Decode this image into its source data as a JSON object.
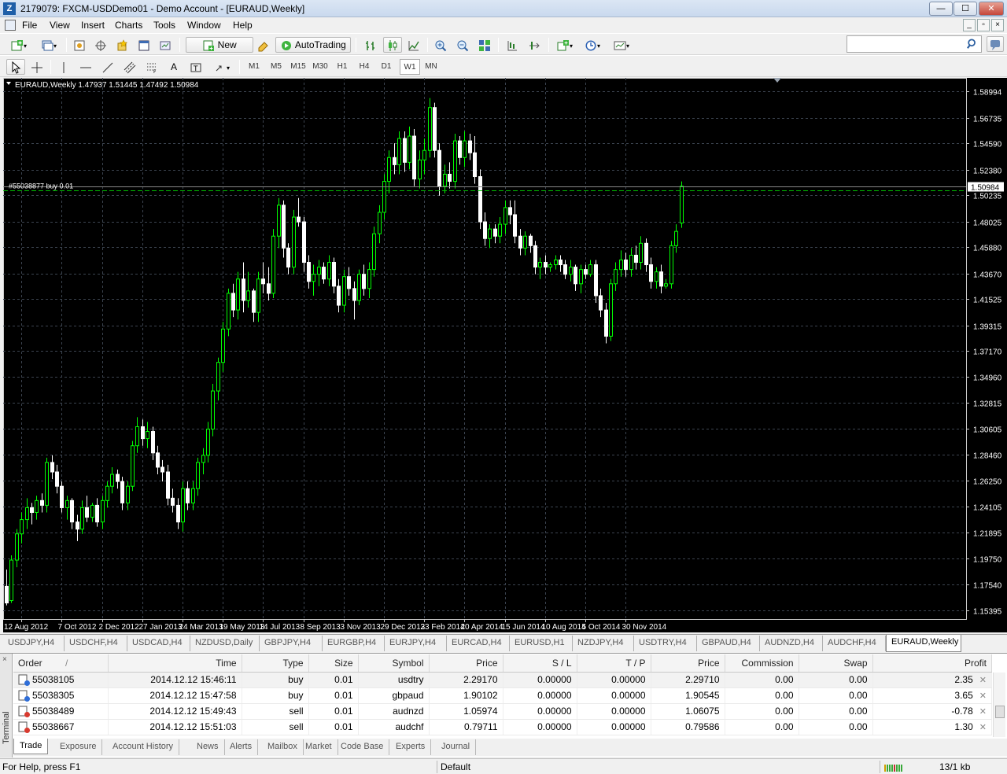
{
  "window": {
    "title": "2179079: FXCM-USDDemo01 - Demo Account - [EURAUD,Weekly]",
    "minimize": "—",
    "maximize": "☐",
    "close": "✕"
  },
  "menu": [
    "File",
    "View",
    "Insert",
    "Charts",
    "Tools",
    "Window",
    "Help"
  ],
  "toolbar": {
    "new_order_label": "New Order",
    "autotrading_label": "AutoTrading",
    "timeframes": [
      "M1",
      "M5",
      "M15",
      "M30",
      "H1",
      "H4",
      "D1",
      "W1",
      "MN"
    ],
    "active_timeframe": "W1",
    "search_placeholder": ""
  },
  "chart": {
    "header": "EURAUD,Weekly  1.47937 1.51445 1.47492 1.50984",
    "order_line_label": "#55038877 buy 0.01",
    "current_price": "1.50984",
    "price_labels": [
      "1.58994",
      "1.56735",
      "1.54590",
      "1.52380",
      "1.50235",
      "1.48025",
      "1.45880",
      "1.43670",
      "1.41525",
      "1.39315",
      "1.37170",
      "1.34960",
      "1.32815",
      "1.30605",
      "1.28460",
      "1.26250",
      "1.24105",
      "1.21895",
      "1.19750",
      "1.17540",
      "1.15395"
    ],
    "date_labels": [
      "12 Aug 2012",
      "7 Oct 2012",
      "2 Dec 2012",
      "27 Jan 2013",
      "24 Mar 2013",
      "19 May 2013",
      "14 Jul 2013",
      "8 Sep 2013",
      "3 Nov 2013",
      "29 Dec 2013",
      "23 Feb 2014",
      "20 Apr 2014",
      "15 Jun 2014",
      "10 Aug 2014",
      "5 Oct 2014",
      "30 Nov 2014"
    ],
    "bull_color": "#00ff00",
    "bear_color": "#ffffff",
    "background": "#000000",
    "grid_color": "#3c4450"
  },
  "chart_tabs": [
    "USDJPY,H4",
    "USDCHF,H4",
    "USDCAD,H4",
    "NZDUSD,Daily",
    "GBPJPY,H4",
    "EURGBP,H4",
    "EURJPY,H4",
    "EURCAD,H4",
    "EURUSD,H1",
    "NZDJPY,H4",
    "USDTRY,H4",
    "GBPAUD,H4",
    "AUDNZD,H4",
    "AUDCHF,H4",
    "EURAUD,Weekly"
  ],
  "active_chart_tab": "EURAUD,Weekly",
  "terminal": {
    "side_label": "Terminal",
    "close_x": "×",
    "columns": [
      "Order",
      "Time",
      "Type",
      "Size",
      "Symbol",
      "Price",
      "S / L",
      "T / P",
      "Price",
      "Commission",
      "Swap",
      "Profit"
    ],
    "sort_marker": "/",
    "rows": [
      {
        "order": "55038105",
        "time": "2014.12.12 15:46:11",
        "type": "buy",
        "size": "0.01",
        "symbol": "usdtry",
        "price": "2.29170",
        "sl": "0.00000",
        "tp": "0.00000",
        "cur_price": "2.29710",
        "commission": "0.00",
        "swap": "0.00",
        "profit": "2.35"
      },
      {
        "order": "55038305",
        "time": "2014.12.12 15:47:58",
        "type": "buy",
        "size": "0.01",
        "symbol": "gbpaud",
        "price": "1.90102",
        "sl": "0.00000",
        "tp": "0.00000",
        "cur_price": "1.90545",
        "commission": "0.00",
        "swap": "0.00",
        "profit": "3.65"
      },
      {
        "order": "55038489",
        "time": "2014.12.12 15:49:43",
        "type": "sell",
        "size": "0.01",
        "symbol": "audnzd",
        "price": "1.05974",
        "sl": "0.00000",
        "tp": "0.00000",
        "cur_price": "1.06075",
        "commission": "0.00",
        "swap": "0.00",
        "profit": "-0.78"
      },
      {
        "order": "55038667",
        "time": "2014.12.12 15:51:03",
        "type": "sell",
        "size": "0.01",
        "symbol": "audchf",
        "price": "0.79711",
        "sl": "0.00000",
        "tp": "0.00000",
        "cur_price": "0.79586",
        "commission": "0.00",
        "swap": "0.00",
        "profit": "1.30"
      }
    ],
    "tabs": [
      "Trade",
      "Exposure",
      "Account History",
      "News",
      "Alerts",
      "Mailbox",
      "Market",
      "Code Base",
      "Experts",
      "Journal"
    ],
    "active_tab": "Trade"
  },
  "status": {
    "help": "For Help, press F1",
    "profile": "Default",
    "traffic": "13/1 kb"
  },
  "chart_data": {
    "type": "candlestick",
    "title": "EURAUD,Weekly",
    "ohlc_last": {
      "open": 1.47937,
      "high": 1.51445,
      "low": 1.47492,
      "close": 1.50984
    },
    "ylim": [
      1.1465,
      1.6009
    ],
    "x_start": "2012-07-22",
    "x_step_days": 7,
    "candles": [
      [
        1.174,
        1.188,
        1.158,
        1.16
      ],
      [
        1.162,
        1.2,
        1.16,
        1.196
      ],
      [
        1.196,
        1.222,
        1.19,
        1.218
      ],
      [
        1.218,
        1.236,
        1.21,
        1.23
      ],
      [
        1.23,
        1.248,
        1.222,
        1.24
      ],
      [
        1.24,
        1.244,
        1.226,
        1.236
      ],
      [
        1.236,
        1.25,
        1.23,
        1.246
      ],
      [
        1.246,
        1.252,
        1.236,
        1.242
      ],
      [
        1.242,
        1.282,
        1.236,
        1.278
      ],
      [
        1.278,
        1.284,
        1.264,
        1.27
      ],
      [
        1.27,
        1.276,
        1.252,
        1.258
      ],
      [
        1.258,
        1.262,
        1.236,
        1.24
      ],
      [
        1.24,
        1.25,
        1.23,
        1.246
      ],
      [
        1.246,
        1.248,
        1.222,
        1.228
      ],
      [
        1.228,
        1.234,
        1.212,
        1.222
      ],
      [
        1.222,
        1.246,
        1.218,
        1.24
      ],
      [
        1.24,
        1.25,
        1.228,
        1.232
      ],
      [
        1.232,
        1.244,
        1.228,
        1.242
      ],
      [
        1.242,
        1.248,
        1.224,
        1.228
      ],
      [
        1.228,
        1.25,
        1.222,
        1.246
      ],
      [
        1.246,
        1.262,
        1.24,
        1.258
      ],
      [
        1.258,
        1.274,
        1.252,
        1.268
      ],
      [
        1.268,
        1.272,
        1.256,
        1.262
      ],
      [
        1.262,
        1.266,
        1.238,
        1.244
      ],
      [
        1.244,
        1.262,
        1.238,
        1.258
      ],
      [
        1.258,
        1.296,
        1.254,
        1.292
      ],
      [
        1.292,
        1.316,
        1.286,
        1.308
      ],
      [
        1.308,
        1.314,
        1.292,
        1.298
      ],
      [
        1.298,
        1.312,
        1.29,
        1.304
      ],
      [
        1.304,
        1.308,
        1.28,
        1.286
      ],
      [
        1.286,
        1.292,
        1.268,
        1.274
      ],
      [
        1.274,
        1.28,
        1.262,
        1.27
      ],
      [
        1.27,
        1.276,
        1.242,
        1.248
      ],
      [
        1.248,
        1.256,
        1.236,
        1.242
      ],
      [
        1.242,
        1.248,
        1.222,
        1.228
      ],
      [
        1.228,
        1.262,
        1.22,
        1.256
      ],
      [
        1.256,
        1.262,
        1.238,
        1.244
      ],
      [
        1.244,
        1.262,
        1.238,
        1.256
      ],
      [
        1.256,
        1.282,
        1.25,
        1.278
      ],
      [
        1.278,
        1.29,
        1.268,
        1.284
      ],
      [
        1.284,
        1.312,
        1.278,
        1.306
      ],
      [
        1.306,
        1.344,
        1.3,
        1.338
      ],
      [
        1.338,
        1.366,
        1.33,
        1.362
      ],
      [
        1.362,
        1.396,
        1.354,
        1.39
      ],
      [
        1.39,
        1.424,
        1.384,
        1.42
      ],
      [
        1.42,
        1.428,
        1.4,
        1.406
      ],
      [
        1.406,
        1.438,
        1.398,
        1.432
      ],
      [
        1.432,
        1.446,
        1.404,
        1.414
      ],
      [
        1.414,
        1.438,
        1.408,
        1.422
      ],
      [
        1.422,
        1.424,
        1.396,
        1.404
      ],
      [
        1.404,
        1.438,
        1.396,
        1.432
      ],
      [
        1.432,
        1.446,
        1.42,
        1.428
      ],
      [
        1.428,
        1.442,
        1.414,
        1.42
      ],
      [
        1.42,
        1.474,
        1.416,
        1.468
      ],
      [
        1.468,
        1.5,
        1.458,
        1.494
      ],
      [
        1.494,
        1.498,
        1.45,
        1.458
      ],
      [
        1.458,
        1.462,
        1.436,
        1.442
      ],
      [
        1.442,
        1.49,
        1.436,
        1.484
      ],
      [
        1.484,
        1.5,
        1.476,
        1.48
      ],
      [
        1.48,
        1.484,
        1.438,
        1.446
      ],
      [
        1.446,
        1.452,
        1.424,
        1.43
      ],
      [
        1.43,
        1.444,
        1.418,
        1.436
      ],
      [
        1.436,
        1.448,
        1.426,
        1.442
      ],
      [
        1.442,
        1.446,
        1.428,
        1.432
      ],
      [
        1.432,
        1.452,
        1.426,
        1.446
      ],
      [
        1.446,
        1.45,
        1.42,
        1.426
      ],
      [
        1.426,
        1.432,
        1.404,
        1.41
      ],
      [
        1.41,
        1.44,
        1.404,
        1.434
      ],
      [
        1.434,
        1.442,
        1.418,
        1.424
      ],
      [
        1.424,
        1.43,
        1.398,
        1.414
      ],
      [
        1.414,
        1.44,
        1.41,
        1.436
      ],
      [
        1.436,
        1.444,
        1.418,
        1.424
      ],
      [
        1.424,
        1.446,
        1.416,
        1.44
      ],
      [
        1.44,
        1.476,
        1.434,
        1.47
      ],
      [
        1.47,
        1.494,
        1.462,
        1.488
      ],
      [
        1.488,
        1.52,
        1.482,
        1.514
      ],
      [
        1.514,
        1.54,
        1.504,
        1.534
      ],
      [
        1.534,
        1.546,
        1.52,
        1.528
      ],
      [
        1.528,
        1.556,
        1.52,
        1.55
      ],
      [
        1.55,
        1.556,
        1.522,
        1.53
      ],
      [
        1.53,
        1.56,
        1.524,
        1.552
      ],
      [
        1.552,
        1.558,
        1.51,
        1.516
      ],
      [
        1.516,
        1.54,
        1.508,
        1.532
      ],
      [
        1.532,
        1.55,
        1.52,
        1.54
      ],
      [
        1.54,
        1.584,
        1.534,
        1.576
      ],
      [
        1.576,
        1.58,
        1.534,
        1.54
      ],
      [
        1.54,
        1.546,
        1.502,
        1.51
      ],
      [
        1.51,
        1.528,
        1.504,
        1.52
      ],
      [
        1.52,
        1.53,
        1.508,
        1.514
      ],
      [
        1.514,
        1.554,
        1.508,
        1.548
      ],
      [
        1.548,
        1.552,
        1.528,
        1.534
      ],
      [
        1.534,
        1.556,
        1.526,
        1.548
      ],
      [
        1.548,
        1.554,
        1.532,
        1.538
      ],
      [
        1.538,
        1.552,
        1.512,
        1.518
      ],
      [
        1.518,
        1.524,
        1.474,
        1.48
      ],
      [
        1.48,
        1.488,
        1.46,
        1.466
      ],
      [
        1.466,
        1.478,
        1.458,
        1.474
      ],
      [
        1.474,
        1.478,
        1.462,
        1.468
      ],
      [
        1.468,
        1.484,
        1.462,
        1.478
      ],
      [
        1.478,
        1.498,
        1.47,
        1.492
      ],
      [
        1.492,
        1.498,
        1.478,
        1.486
      ],
      [
        1.486,
        1.498,
        1.462,
        1.468
      ],
      [
        1.468,
        1.474,
        1.452,
        1.458
      ],
      [
        1.458,
        1.472,
        1.452,
        1.468
      ],
      [
        1.468,
        1.47,
        1.454,
        1.46
      ],
      [
        1.46,
        1.464,
        1.436,
        1.442
      ],
      [
        1.442,
        1.45,
        1.432,
        1.446
      ],
      [
        1.446,
        1.452,
        1.436,
        1.442
      ],
      [
        1.442,
        1.446,
        1.438,
        1.444
      ],
      [
        1.444,
        1.452,
        1.44,
        1.448
      ],
      [
        1.448,
        1.452,
        1.438,
        1.444
      ],
      [
        1.444,
        1.448,
        1.432,
        1.436
      ],
      [
        1.436,
        1.448,
        1.43,
        1.442
      ],
      [
        1.442,
        1.444,
        1.422,
        1.428
      ],
      [
        1.428,
        1.444,
        1.42,
        1.44
      ],
      [
        1.44,
        1.444,
        1.432,
        1.436
      ],
      [
        1.436,
        1.448,
        1.434,
        1.444
      ],
      [
        1.444,
        1.448,
        1.412,
        1.418
      ],
      [
        1.418,
        1.424,
        1.4,
        1.406
      ],
      [
        1.406,
        1.412,
        1.378,
        1.384
      ],
      [
        1.384,
        1.432,
        1.38,
        1.428
      ],
      [
        1.428,
        1.446,
        1.422,
        1.44
      ],
      [
        1.44,
        1.456,
        1.434,
        1.448
      ],
      [
        1.448,
        1.454,
        1.434,
        1.44
      ],
      [
        1.44,
        1.458,
        1.434,
        1.452
      ],
      [
        1.452,
        1.46,
        1.44,
        1.446
      ],
      [
        1.446,
        1.468,
        1.44,
        1.462
      ],
      [
        1.462,
        1.466,
        1.438,
        1.444
      ],
      [
        1.444,
        1.45,
        1.424,
        1.43
      ],
      [
        1.43,
        1.442,
        1.424,
        1.438
      ],
      [
        1.438,
        1.444,
        1.42,
        1.426
      ],
      [
        1.426,
        1.432,
        1.424,
        1.428
      ],
      [
        1.428,
        1.464,
        1.424,
        1.46
      ],
      [
        1.46,
        1.478,
        1.454,
        1.472
      ],
      [
        1.479,
        1.514,
        1.475,
        1.51
      ]
    ]
  }
}
